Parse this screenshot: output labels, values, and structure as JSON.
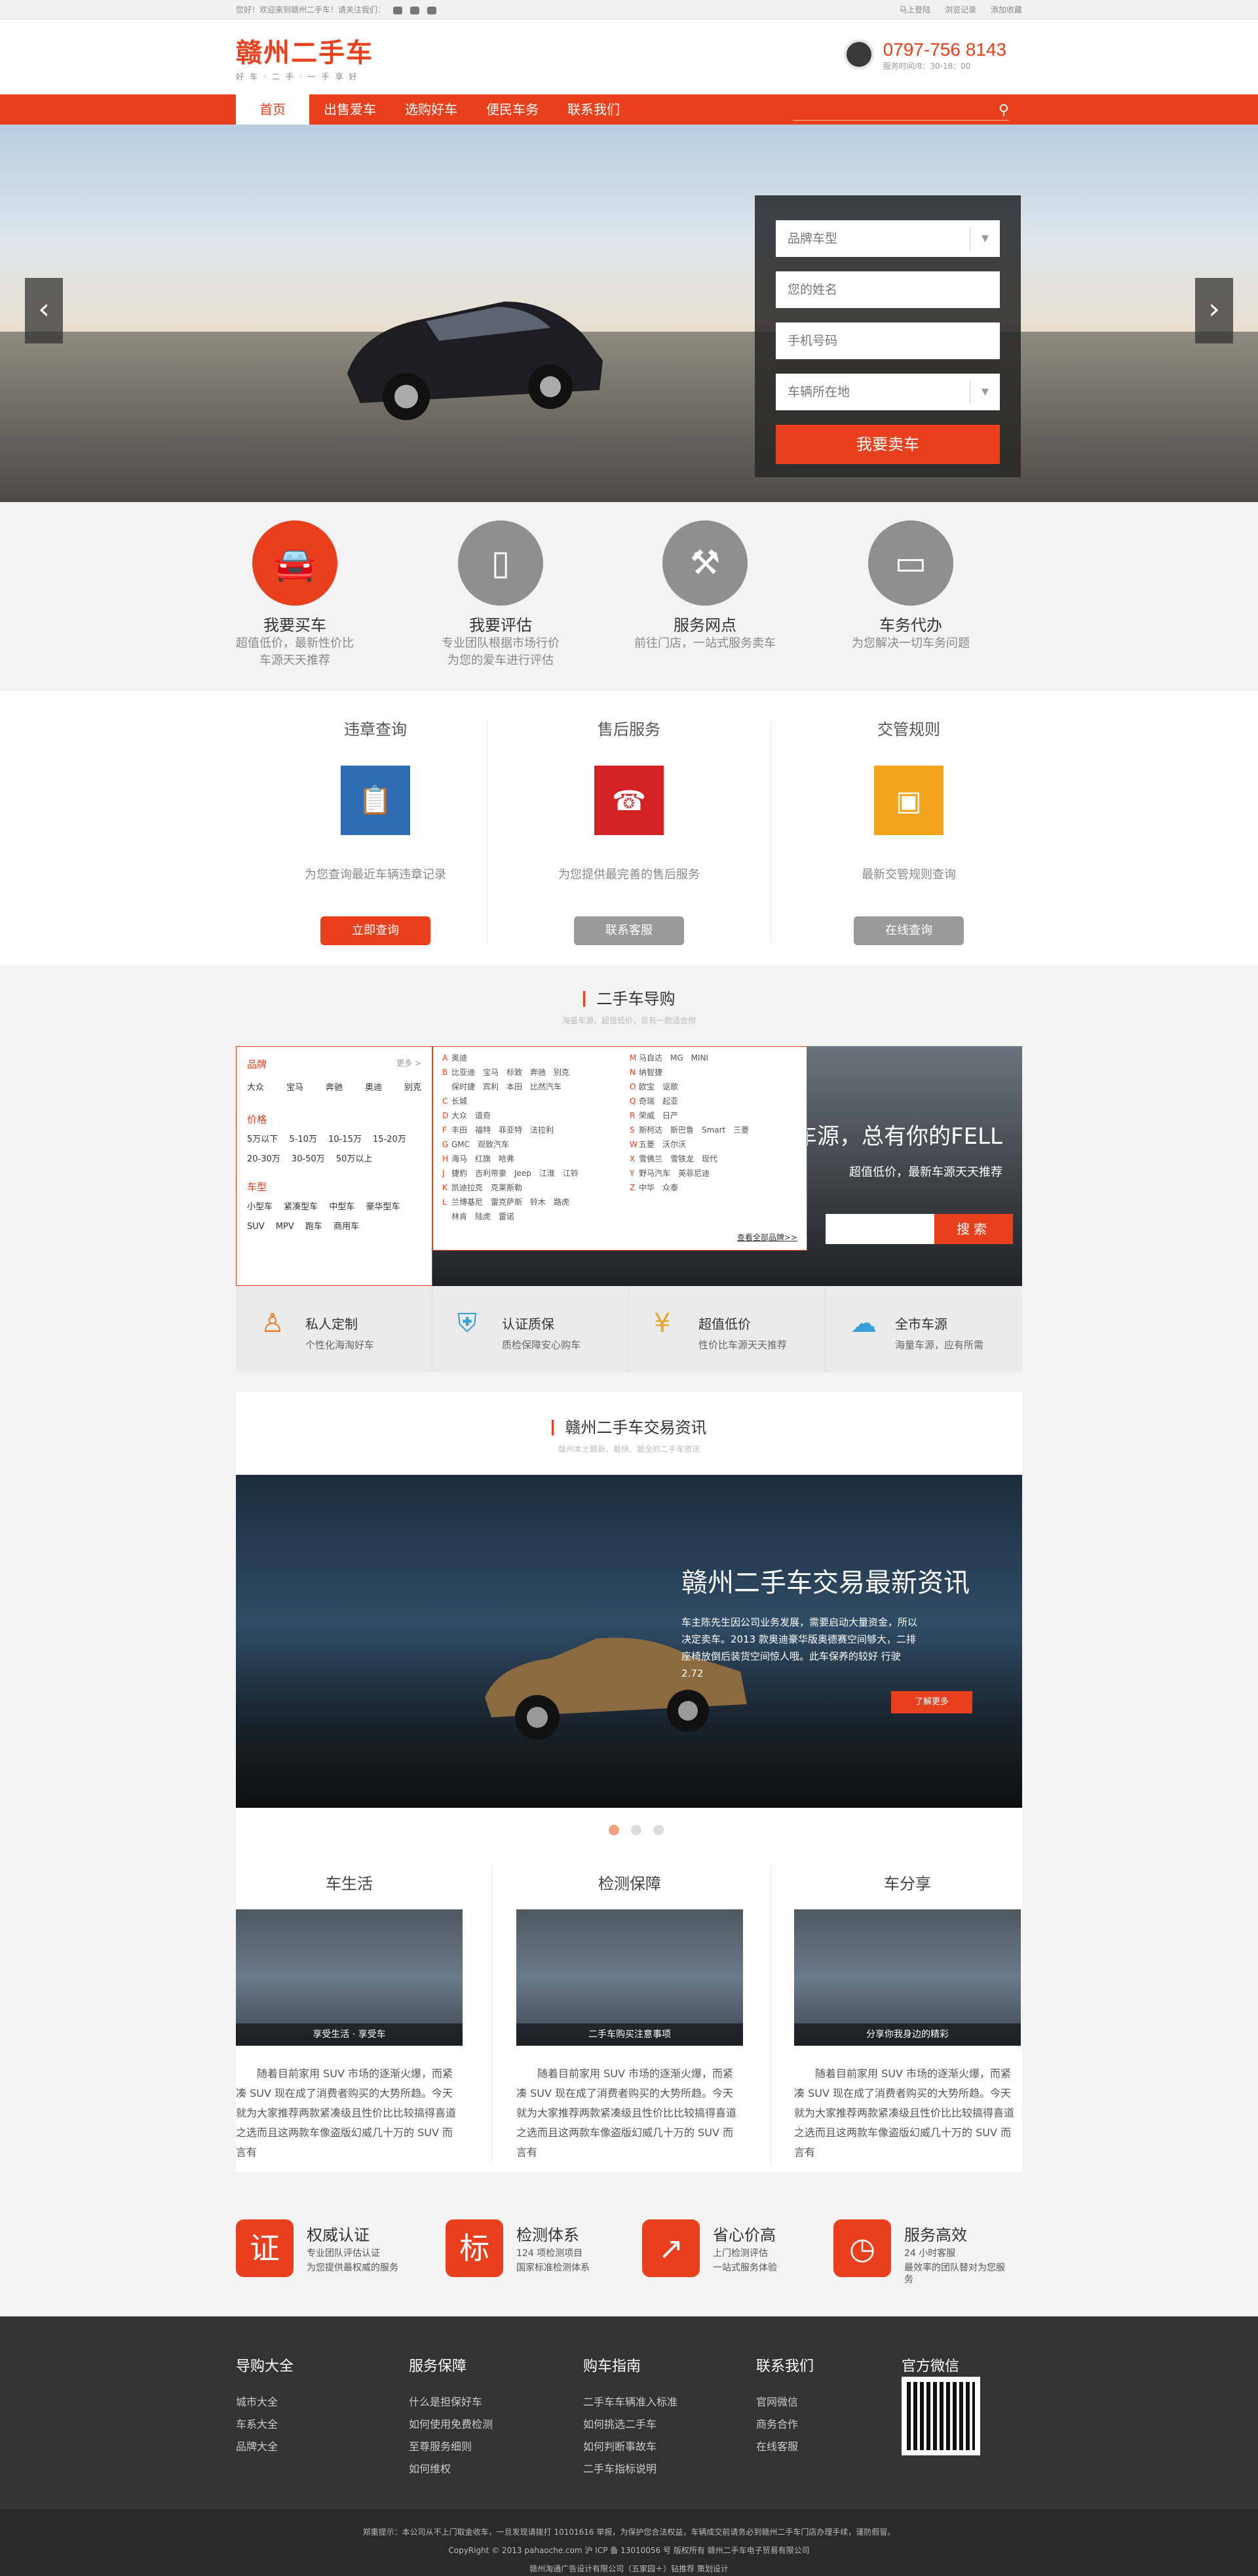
{
  "topbar": {
    "welcome": "您好！欢迎来到赣州二手车！请关注我们：",
    "links": [
      "马上登陆",
      "浏览记录",
      "添加收藏"
    ]
  },
  "header": {
    "logo": "赣州二手车",
    "slogan": "好车·二手·一手享好",
    "phone": "0797-756 8143",
    "service_time": "服务时间/8：30-18：00"
  },
  "nav": {
    "items": [
      "首页",
      "出售爱车",
      "选购好车",
      "便民车务",
      "联系我们"
    ],
    "search_placeholder": ""
  },
  "banner_form": {
    "brand": "品牌车型",
    "name": "您的姓名",
    "phone": "手机号码",
    "location": "车辆所在地",
    "submit": "我要卖车"
  },
  "services": [
    {
      "title": "我要买车",
      "desc1": "超值低价，最新性价比",
      "desc2": "车源天天推荐"
    },
    {
      "title": "我要评估",
      "desc1": "专业团队根据市场行价",
      "desc2": "为您的爱车进行评估"
    },
    {
      "title": "服务网点",
      "desc1": "前往门店，一站式服务卖车",
      "desc2": ""
    },
    {
      "title": "车务代办",
      "desc1": "为您解决一切车务问题",
      "desc2": ""
    }
  ],
  "query": [
    {
      "title": "违章查询",
      "desc": "为您查询最近车辆违章记录",
      "btn": "立即查询"
    },
    {
      "title": "售后服务",
      "desc": "为您提供最完善的售后服务",
      "btn": "联系客服"
    },
    {
      "title": "交管规则",
      "desc": "最新交管规则查询",
      "btn": "在线查询"
    }
  ],
  "guide": {
    "title": "二手车导购",
    "subtitle": "海量车源、超值低价，总有一款适合你",
    "brand_label": "品牌",
    "more": "更多 >",
    "brands": [
      "大众",
      "宝马",
      "奔驰",
      "奥迪",
      "别克"
    ],
    "price_label": "价格",
    "prices": [
      "5万以下",
      "5-10万",
      "10-15万",
      "15-20万",
      "20-30万",
      "30-50万",
      "50万以上"
    ],
    "type_label": "车型",
    "types": [
      "小型车",
      "紧凑型车",
      "中型车",
      "豪华型车",
      "SUV",
      "MPV",
      "跑车",
      "商用车"
    ],
    "letters": [
      {
        "l": "A",
        "b": "奥迪"
      },
      {
        "l": "B",
        "b": "比亚迪　宝马　标致　奔驰　别克"
      },
      {
        "l": "",
        "b": "保时捷　宾利　本田　比然汽车"
      },
      {
        "l": "C",
        "b": "长城"
      },
      {
        "l": "D",
        "b": "大众　道奇"
      },
      {
        "l": "F",
        "b": "丰田　福特　菲亚特　法拉利"
      },
      {
        "l": "G",
        "b": "GMC　观致汽车"
      },
      {
        "l": "H",
        "b": "海马　红旗　哈弗"
      },
      {
        "l": "J",
        "b": "捷豹　吉利帝豪　Jeep　江淮　江铃"
      },
      {
        "l": "K",
        "b": "凯迪拉克　克莱斯勒"
      },
      {
        "l": "L",
        "b": "兰博基尼　雷克萨斯　铃木　路虎"
      },
      {
        "l": "",
        "b": "林肯　陆虎　雷诺"
      }
    ],
    "letters2": [
      {
        "l": "M",
        "b": "马自达　MG　MINI"
      },
      {
        "l": "N",
        "b": "纳智捷"
      },
      {
        "l": "O",
        "b": "欧宝　讴歌"
      },
      {
        "l": "Q",
        "b": "奇瑞　起亚"
      },
      {
        "l": "R",
        "b": "荣威　日产"
      },
      {
        "l": "S",
        "b": "斯柯达　斯巴鲁　Smart　三菱"
      },
      {
        "l": "W",
        "b": "五菱　沃尔沃"
      },
      {
        "l": "X",
        "b": "雪佛兰　雪铁龙　现代"
      },
      {
        "l": "Y",
        "b": "野马汽车　英菲尼迪"
      },
      {
        "l": "Z",
        "b": "中华　众泰"
      }
    ],
    "all_brands": "查看全部品牌>>",
    "slogan": "海量车源，总有你的FELL",
    "slogan2": "超值低价，最新车源天天推荐",
    "search_btn": "搜索",
    "features": [
      {
        "title": "私人定制",
        "desc": "个性化海淘好车"
      },
      {
        "title": "认证质保",
        "desc": "质检保障安心购车"
      },
      {
        "title": "超值低价",
        "desc": "性价比车源天天推荐"
      },
      {
        "title": "全市车源",
        "desc": "海量车源，应有所需"
      }
    ]
  },
  "news": {
    "title": "赣州二手车交易资讯",
    "subtitle": "赣州本土最新、最快、最全的二手车资讯",
    "banner_title": "赣州二手车交易最新资讯",
    "banner_desc": "车主陈先生因公司业务发展，需要启动大量资金，所以决定卖车。2013 款奥迪豪华版奥德赛空间够大，二排座椅放倒后装货空间惊人哦。此车保养的较好 行驶 2.72",
    "more": "了解更多",
    "cols": [
      {
        "title": "车生活",
        "caption": "享受生活 · 享受车",
        "text": "随着目前家用 SUV 市场的逐渐火爆，而紧凑 SUV 现在成了消费者购买的大势所趋。今天就为大家推荐两款紧凑级且性价比比较搞得喜道之选而且这两款车像盗版幻威几十万的 SUV 而言有"
      },
      {
        "title": "检测保障",
        "caption": "二手车购买注意事项",
        "text": "随着目前家用 SUV 市场的逐渐火爆，而紧凑 SUV 现在成了消费者购买的大势所趋。今天就为大家推荐两款紧凑级且性价比比较搞得喜道之选而且这两款车像盗版幻威几十万的 SUV 而言有"
      },
      {
        "title": "车分享",
        "caption": "分享你我身边的精彩",
        "text": "随着目前家用 SUV 市场的逐渐火爆，而紧凑 SUV 现在成了消费者购买的大势所趋。今天就为大家推荐两款紧凑级且性价比比较搞得喜道之选而且这两款车像盗版幻威几十万的 SUV 而言有"
      }
    ]
  },
  "badges": [
    {
      "icon": "证",
      "title": "权威认证",
      "d1": "专业团队评估认证",
      "d2": "为您提供最权威的服务"
    },
    {
      "icon": "标",
      "title": "检测体系",
      "d1": "124 项检测项目",
      "d2": "国家标准检测体系"
    },
    {
      "icon": "↗",
      "title": "省心价高",
      "d1": "上门检测评估",
      "d2": "一站式服务体验"
    },
    {
      "icon": "◷",
      "title": "服务高效",
      "d1": "24 小时客服",
      "d2": "最效率的团队替对为您服务"
    }
  ],
  "footer": {
    "cols": [
      {
        "title": "导购大全",
        "items": [
          "城市大全",
          "车系大全",
          "品牌大全"
        ]
      },
      {
        "title": "服务保障",
        "items": [
          "什么是担保好车",
          "如何使用免费检测",
          "至尊服务细则",
          "如何维权"
        ]
      },
      {
        "title": "购车指南",
        "items": [
          "二手车车辆准入标准",
          "如何挑选二手车",
          "如何判断事故车",
          "二手车指标说明"
        ]
      },
      {
        "title": "联系我们",
        "items": [
          "官网微信",
          "商务合作",
          "在线客服"
        ]
      }
    ],
    "wechat_title": "官方微信",
    "notice": "郑重提示：本公司从不上门取金收车，一旦发现请拨打 10101616 举报，为保护您合法权益，车辆成交前请务必到赣州二手车门店办理手续，谨防假冒。",
    "copyright": "CopyRight © 2013 pahaoche.com 沪 ICP 备 13010056 号 版权所有 赣州二手车电子贸易有限公司",
    "company": "赣州淘通广告设计有限公司（五家园＋）钻推荐 策划设计"
  }
}
